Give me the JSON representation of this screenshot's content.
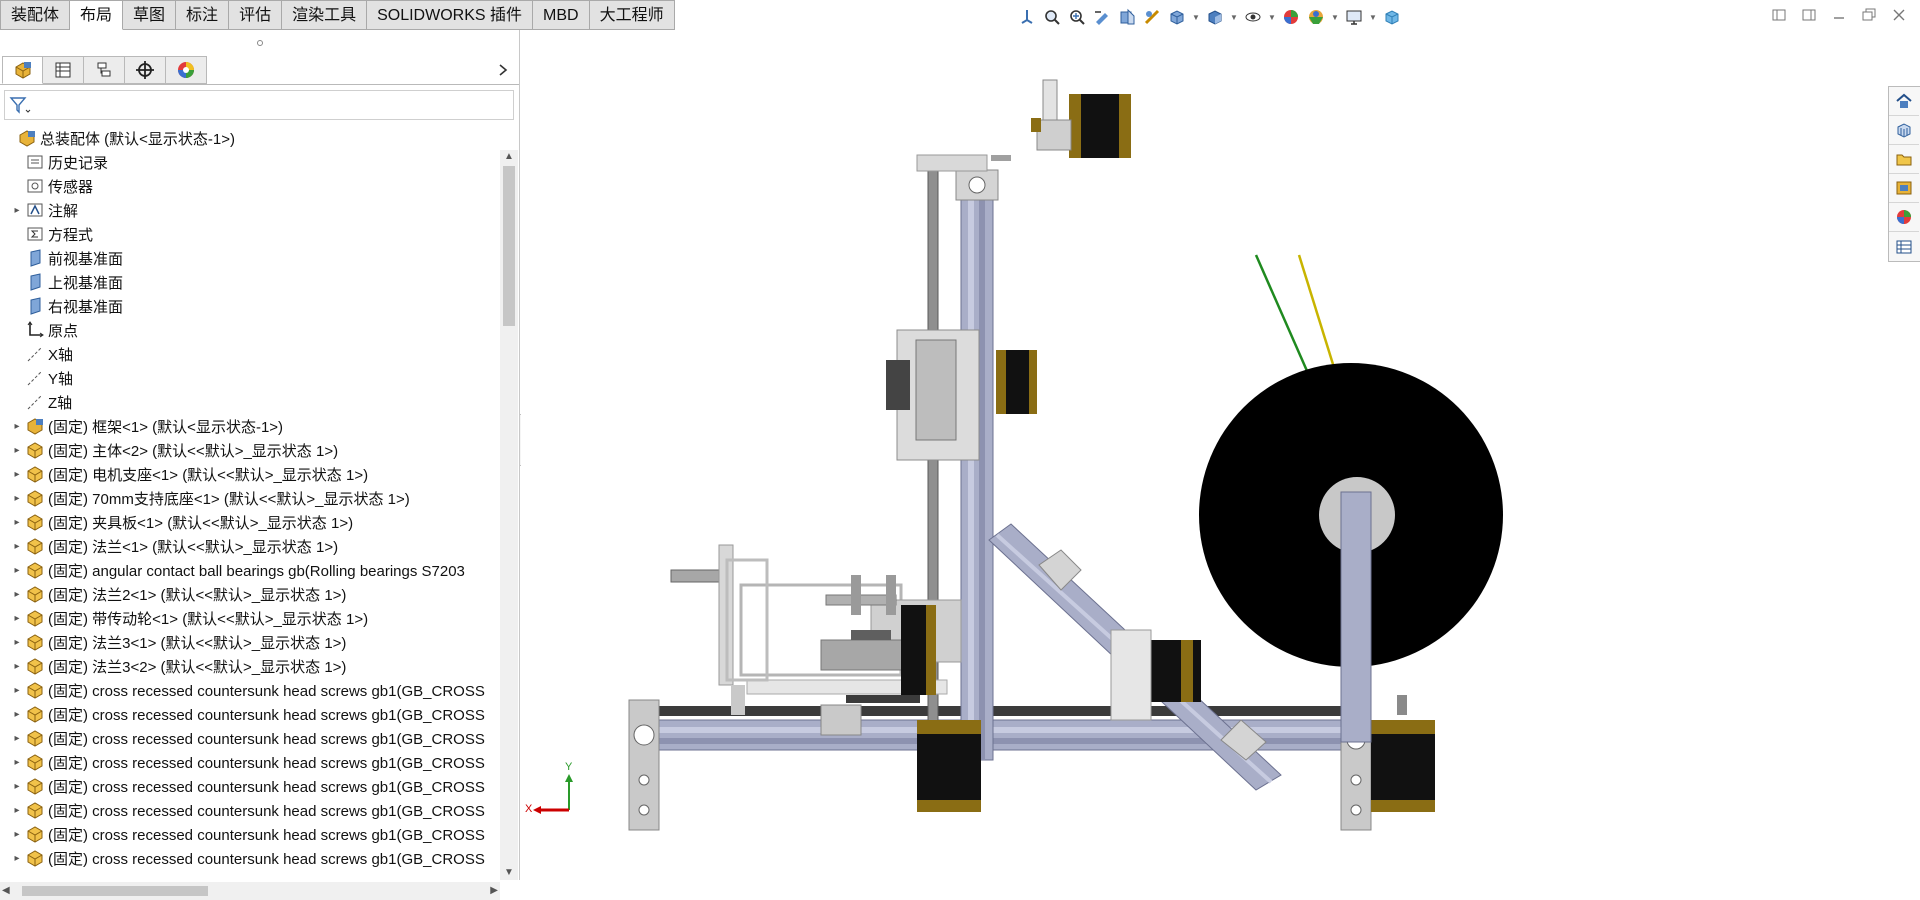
{
  "command_tabs": [
    "装配体",
    "布局",
    "草图",
    "标注",
    "评估",
    "渲染工具",
    "SOLIDWORKS 插件",
    "MBD",
    "大工程师"
  ],
  "active_tab": "布局",
  "view_toolbar_icons": [
    "view-orientation-icon",
    "zoom-to-fit-icon",
    "zoom-to-area-icon",
    "previous-view-icon",
    "section-view-icon",
    "dynamic-annotation-icon",
    "view-orientation-cube-icon",
    "display-style-icon",
    "hide-show-icon",
    "edit-appearance-icon",
    "apply-scene-icon",
    "view-settings-icon",
    "3d-view-icon"
  ],
  "tree": {
    "root": "总装配体  (默认<显示状态-1>)",
    "items": [
      {
        "label": "历史记录",
        "icon": "history-icon",
        "expandable": false
      },
      {
        "label": "传感器",
        "icon": "sensor-icon",
        "expandable": false
      },
      {
        "label": "注解",
        "icon": "annotation-icon",
        "expandable": true
      },
      {
        "label": "方程式",
        "icon": "equation-icon",
        "expandable": false
      },
      {
        "label": "前视基准面",
        "icon": "plane-icon",
        "expandable": false
      },
      {
        "label": "上视基准面",
        "icon": "plane-icon",
        "expandable": false
      },
      {
        "label": "右视基准面",
        "icon": "plane-icon",
        "expandable": false
      },
      {
        "label": "原点",
        "icon": "origin-icon",
        "expandable": false
      },
      {
        "label": "X轴",
        "icon": "axis-icon",
        "expandable": false
      },
      {
        "label": "Y轴",
        "icon": "axis-icon",
        "expandable": false
      },
      {
        "label": "Z轴",
        "icon": "axis-icon",
        "expandable": false
      },
      {
        "label": "(固定) 框架<1> (默认<显示状态-1>)",
        "icon": "subassembly-icon",
        "expandable": true
      },
      {
        "label": "(固定) 主体<2> (默认<<默认>_显示状态 1>)",
        "icon": "part-icon",
        "expandable": true
      },
      {
        "label": "(固定) 电机支座<1> (默认<<默认>_显示状态 1>)",
        "icon": "part-icon",
        "expandable": true
      },
      {
        "label": "(固定) 70mm支持底座<1> (默认<<默认>_显示状态 1>)",
        "icon": "part-icon",
        "expandable": true
      },
      {
        "label": "(固定) 夹具板<1> (默认<<默认>_显示状态 1>)",
        "icon": "part-icon",
        "expandable": true
      },
      {
        "label": "(固定) 法兰<1> (默认<<默认>_显示状态 1>)",
        "icon": "part-icon",
        "expandable": true
      },
      {
        "label": "(固定) angular contact ball bearings gb(Rolling bearings S7203",
        "icon": "part-icon",
        "expandable": true
      },
      {
        "label": "(固定) 法兰2<1> (默认<<默认>_显示状态 1>)",
        "icon": "part-icon",
        "expandable": true
      },
      {
        "label": "(固定) 带传动轮<1> (默认<<默认>_显示状态 1>)",
        "icon": "part-icon",
        "expandable": true
      },
      {
        "label": "(固定) 法兰3<1> (默认<<默认>_显示状态 1>)",
        "icon": "part-icon",
        "expandable": true
      },
      {
        "label": "(固定) 法兰3<2> (默认<<默认>_显示状态 1>)",
        "icon": "part-icon",
        "expandable": true
      },
      {
        "label": "(固定) cross recessed countersunk head screws gb1(GB_CROSS",
        "icon": "part-icon",
        "expandable": true
      },
      {
        "label": "(固定) cross recessed countersunk head screws gb1(GB_CROSS",
        "icon": "part-icon",
        "expandable": true
      },
      {
        "label": "(固定) cross recessed countersunk head screws gb1(GB_CROSS",
        "icon": "part-icon",
        "expandable": true
      },
      {
        "label": "(固定) cross recessed countersunk head screws gb1(GB_CROSS",
        "icon": "part-icon",
        "expandable": true
      },
      {
        "label": "(固定) cross recessed countersunk head screws gb1(GB_CROSS",
        "icon": "part-icon",
        "expandable": true
      },
      {
        "label": "(固定) cross recessed countersunk head screws gb1(GB_CROSS",
        "icon": "part-icon",
        "expandable": true
      },
      {
        "label": "(固定) cross recessed countersunk head screws gb1(GB_CROSS",
        "icon": "part-icon",
        "expandable": true
      },
      {
        "label": "(固定) cross recessed countersunk head screws gb1(GB_CROSS",
        "icon": "part-icon",
        "expandable": true
      }
    ]
  },
  "triad": {
    "x_label": "X",
    "y_label": "Y"
  },
  "colors": {
    "profile": "#a9aec8",
    "motor_body": "#111111",
    "motor_accent": "#8a6d14",
    "spool": "#000000",
    "axis_x": "#cc0000",
    "axis_y": "#2a9a2a",
    "filament_green": "#1f8a1f",
    "filament_yellow": "#c8b400"
  }
}
